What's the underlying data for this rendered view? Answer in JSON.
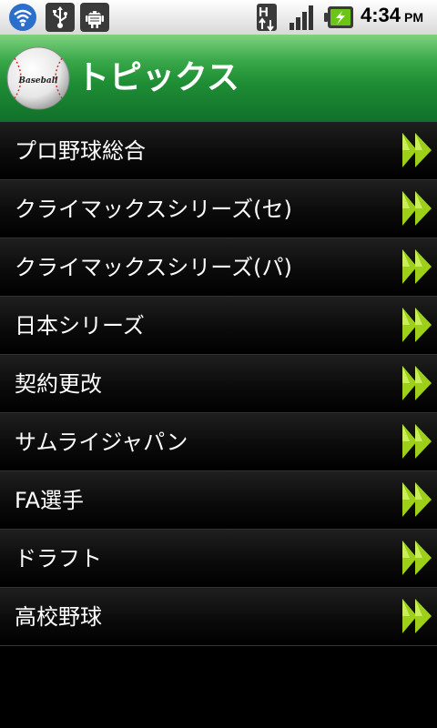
{
  "status_bar": {
    "time": "4:34",
    "ampm": "PM",
    "icons": [
      "wifi-icon",
      "usb-icon",
      "android-debug-icon",
      "hsdpa-network-icon",
      "signal-icon",
      "battery-charging-icon"
    ]
  },
  "header": {
    "title": "トピックス",
    "logo_text": "Baseball"
  },
  "list": {
    "items": [
      {
        "label": "プロ野球総合"
      },
      {
        "label": "クライマックスシリーズ(セ)"
      },
      {
        "label": "クライマックスシリーズ(パ)"
      },
      {
        "label": "日本シリーズ"
      },
      {
        "label": "契約更改"
      },
      {
        "label": "サムライジャパン"
      },
      {
        "label": "FA選手"
      },
      {
        "label": "ドラフト"
      },
      {
        "label": "高校野球"
      }
    ]
  },
  "colors": {
    "header_green": "#1f8e35",
    "arrow_green": "#9ed01a",
    "background": "#000000"
  }
}
